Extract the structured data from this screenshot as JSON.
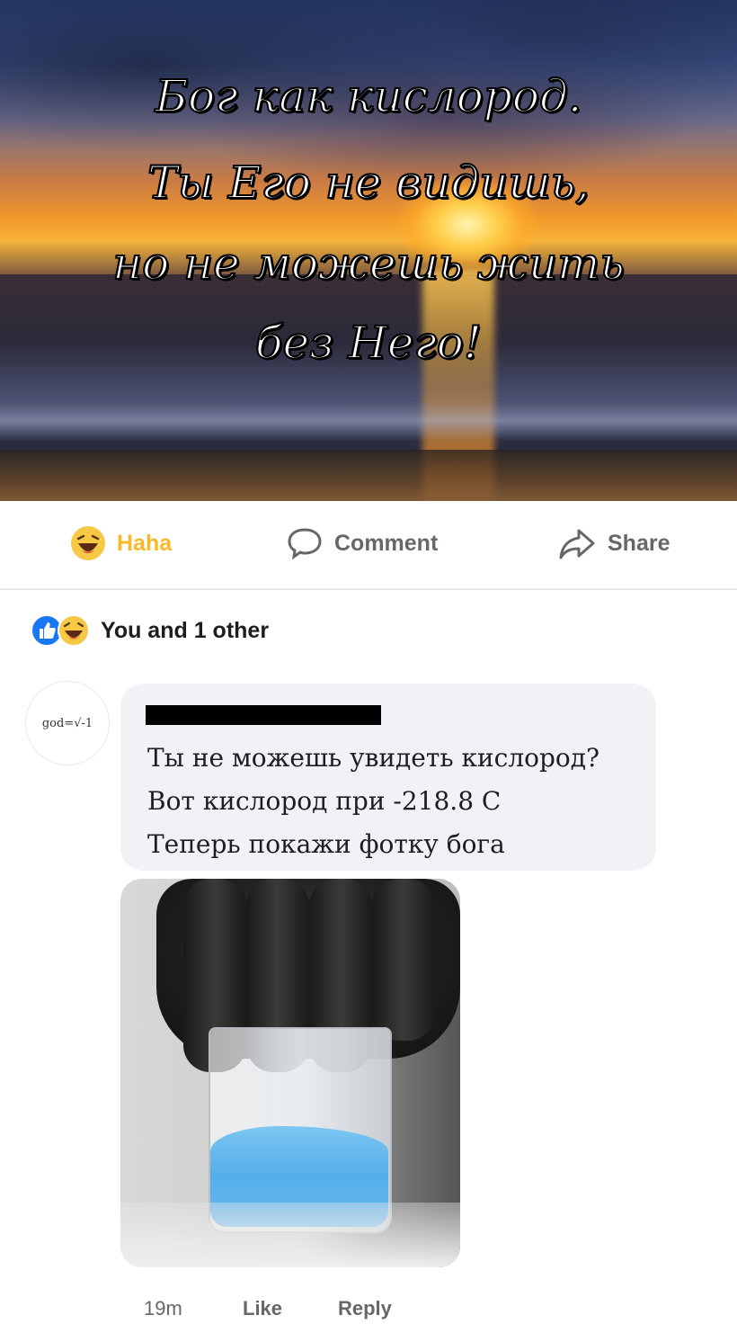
{
  "post": {
    "image_quote": [
      "Бог как кислород.",
      "Ты Его не видишь,",
      "но не можешь жить",
      "без Него!"
    ]
  },
  "actions": {
    "haha_label": "Haha",
    "comment_label": "Comment",
    "share_label": "Share",
    "haha_color": "#f7b928"
  },
  "reactions": {
    "icons": [
      "like-icon",
      "haha-icon"
    ],
    "summary": "You and 1 other"
  },
  "comment": {
    "avatar_text": "god=√-1",
    "lines": [
      "Ты не можешь увидеть кислород?",
      "Вот кислород при -218.8 C",
      "Теперь покажи фотку бога"
    ],
    "time": "19m",
    "like_label": "Like",
    "reply_label": "Reply"
  },
  "colors": {
    "like_blue": "#1877f2",
    "muted_text": "#65676b",
    "bubble_bg": "#f0f2f5"
  }
}
